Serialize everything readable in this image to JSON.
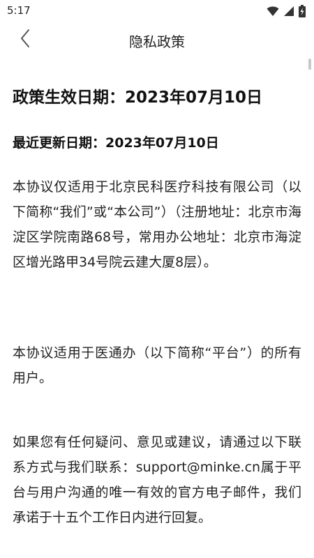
{
  "status_bar": {
    "time": "5:17",
    "icons": [
      "wifi-icon",
      "signal-icon",
      "battery-charging-icon"
    ]
  },
  "header": {
    "title": "隐私政策",
    "back_icon": "chevron-left-icon"
  },
  "content": {
    "effective_date": "政策生效日期：2023年07月10日",
    "updated_date": "最近更新日期：2023年07月10日",
    "paragraphs": [
      "本协议仅适用于北京民科医疗科技有限公司（以下简称“我们”或“本公司”）（注册地址：北京市海淀区学院南路68号，常用办公地址：北京市海淀区增光路甲34号院云建大厦8层）。",
      "本协议适用于医通办（以下简称“平台”）的所有用户。",
      "如果您有任何疑问、意见或建议，请通过以下联系方式与我们联系：support@minke.cn属于平台与用户沟通的唯一有效的官方电子邮件，我们承诺于十五个工作日内进行回复。"
    ]
  },
  "colors": {
    "background": "#ffffff",
    "text": "#222222",
    "icon": "#444444"
  }
}
